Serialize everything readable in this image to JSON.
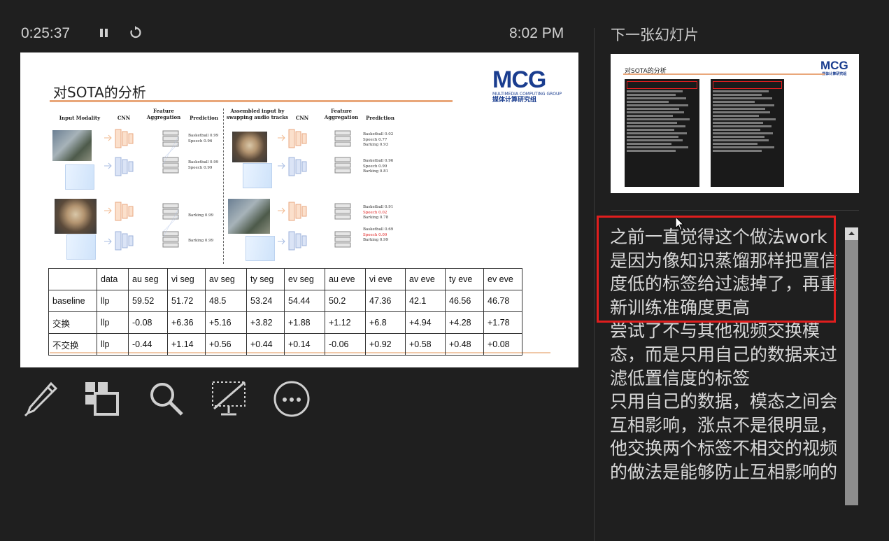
{
  "presenter": {
    "elapsed_time": "0:25:37",
    "pause_icon": "pause-icon",
    "restart_icon": "restart-icon",
    "clock": "8:02 PM"
  },
  "current_slide": {
    "title": "对SOTA的分析",
    "logo": {
      "main": "MCG",
      "sub": "MULTIMEDIA COMPUTING GROUP",
      "cn": "媒体计算研究组"
    },
    "diagram": {
      "headers_left": [
        "Input Modality",
        "CNN",
        "Feature Aggregation",
        "Prediction"
      ],
      "headers_right": [
        "Assembled input by swapping audio tracks",
        "CNN",
        "Feature Aggregation",
        "Prediction"
      ],
      "pred_left_1": [
        "Basketball 0.99",
        "Speech 0.96"
      ],
      "pred_left_2": [
        "Basketball 0.99",
        "Speech 0.99"
      ],
      "pred_left_3": [
        "Barking 0.99"
      ],
      "pred_left_4": [
        "Barking 0.99"
      ],
      "pred_right_1": [
        "Basketball 0.02",
        "Speech 0.77",
        "Barking 0.93"
      ],
      "pred_right_2": [
        "Basketball 0.96",
        "Speech 0.99",
        "Barking 0.81"
      ],
      "pred_right_3": [
        "Basketball 0.91",
        "Speech 0.02",
        "Barking 0.78"
      ],
      "pred_right_4": [
        "Basketball 0.69",
        "Speech 0.09",
        "Barking 0.99"
      ]
    },
    "table": {
      "header": [
        "",
        "data",
        "au seg",
        "vi seg",
        "av seg",
        "ty seg",
        "ev seg",
        "au eve",
        "vi eve",
        "av eve",
        "ty eve",
        "ev eve"
      ],
      "rows": [
        [
          "baseline",
          "llp",
          "59.52",
          "51.72",
          "48.5",
          "53.24",
          "54.44",
          "50.2",
          "47.36",
          "42.1",
          "46.56",
          "46.78"
        ],
        [
          "交换",
          "llp",
          "-0.08",
          "+6.36",
          "+5.16",
          "+3.82",
          "+1.88",
          "+1.12",
          "+6.8",
          "+4.94",
          "+4.28",
          "+1.78"
        ],
        [
          "不交换",
          "llp",
          "-0.44",
          "+1.14",
          "+0.56",
          "+0.44",
          "+0.14",
          "-0.06",
          "+0.92",
          "+0.58",
          "+0.48",
          "+0.08"
        ]
      ]
    }
  },
  "next_slide": {
    "label": "下一张幻灯片",
    "title": "对SOTA的分析",
    "logo_main": "MCG",
    "logo_cn": "媒体计算研究组"
  },
  "tools": [
    {
      "name": "pen-tool",
      "icon": "pen-icon"
    },
    {
      "name": "see-all-slides",
      "icon": "slides-grid-icon"
    },
    {
      "name": "zoom",
      "icon": "magnifier-icon"
    },
    {
      "name": "black-screen",
      "icon": "screen-off-icon"
    },
    {
      "name": "more-options",
      "icon": "ellipsis-icon"
    }
  ],
  "notes": {
    "text": "之前一直觉得这个做法work是因为像知识蒸馏那样把置信度低的标签给过滤掉了，再重新训练准确度更高\n尝试了不与其他视频交换模态，而是只用自己的数据来过滤低置信度的标签\n只用自己的数据，模态之间会互相影响，涨点不是很明显，他交换两个标签不相交的视频的做法是能够防止互相影响的"
  },
  "colors": {
    "background": "#1f1f1f",
    "highlight": "#e01e1e",
    "title_rule": "#e9a77a",
    "logo": "#1a3d8f"
  }
}
